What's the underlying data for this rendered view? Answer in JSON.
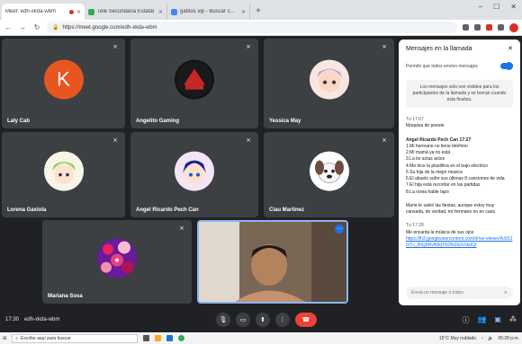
{
  "browser": {
    "tabs": [
      {
        "title": "Meet: edh-xkda-wbm",
        "active": true
      },
      {
        "title": "Tele Secundaria Estatal",
        "active": false
      },
      {
        "title": "gatitos vip - Buscar con Google",
        "active": false
      }
    ],
    "new_tab": "+",
    "url": "https://meet.google.com/edh-xkda-wbm"
  },
  "participants": [
    {
      "name": "Laly Cab",
      "initial": "K",
      "avatar": "letter"
    },
    {
      "name": "Angelito Gaming",
      "avatar": "logo"
    },
    {
      "name": "Yessica May",
      "avatar": "anime"
    },
    {
      "name": "Lorena Gaxiola",
      "avatar": "anime-green"
    },
    {
      "name": "Angel Ricardo Pech Can",
      "avatar": "anime-blue"
    },
    {
      "name": "Ciau Martinez",
      "avatar": "dog"
    },
    {
      "name": "Mariana Sosa",
      "avatar": "flowers"
    }
  ],
  "chat": {
    "title": "Mensajes en la llamada",
    "toggle_label": "Permitir que todos envíen mensajes",
    "notice": "Los mensajes solo son visibles para los participantes de la llamada y se borran cuando esta finaliza.",
    "messages": [
      {
        "author": "Tú 17:07",
        "lines": [
          "Maquina de poeste"
        ]
      },
      {
        "author": "Angel Ricardo Pech Can 17:27",
        "lines": [
          "1.Mi hermano no tiene teléfono",
          "2.Mi mamá ya no está",
          "3.La tio actas actos",
          "4.Me hice la plastilina en el bajo eléctrico",
          "5.Su hija de la mejor música",
          "6.El abuelo sufre sus últimas 8 canciones de vida",
          "7.El hija está recordar en las partidas",
          "8.La novia hable tapo"
        ]
      },
      {
        "author": "",
        "lines": [
          "Maria te salvó las fiestas, aunque estoy muy cansada, de verdad, mi hermano no en casa"
        ]
      },
      {
        "author": "Tú 17:28",
        "lines": [
          "Me encanta la música de sus ojos"
        ],
        "link": "https://lh3.googleusercontent.com/drive-viewer/AJc5JmTv_0hQbRvN9qTKDNZk2xXkdQr"
      }
    ],
    "input_placeholder": "Envía un mensaje a todos"
  },
  "controls": {
    "time": "17:30",
    "meeting_code": "edh-xkda-wbm"
  },
  "taskbar": {
    "search_placeholder": "Escribe aquí para buscar",
    "weather": "15°C Muy nublado",
    "clock": "05:28 p.m."
  }
}
